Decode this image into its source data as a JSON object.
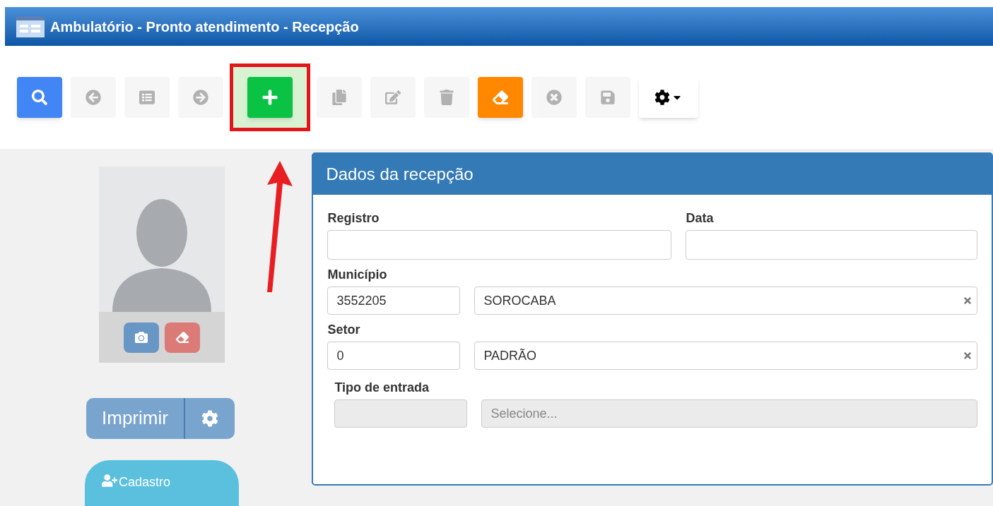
{
  "window": {
    "title": "Ambulatório - Pronto atendimento - Recepção"
  },
  "toolbar": [
    {
      "kind": "search",
      "disabled": false,
      "highlighted": false
    },
    {
      "kind": "previous",
      "disabled": true,
      "highlighted": false
    },
    {
      "kind": "list",
      "disabled": true,
      "highlighted": false
    },
    {
      "kind": "next",
      "disabled": true,
      "highlighted": false
    },
    {
      "kind": "add",
      "disabled": false,
      "highlighted": true
    },
    {
      "kind": "copy",
      "disabled": true,
      "highlighted": false
    },
    {
      "kind": "edit",
      "disabled": true,
      "highlighted": false
    },
    {
      "kind": "delete",
      "disabled": true,
      "highlighted": false
    },
    {
      "kind": "clear",
      "disabled": false,
      "highlighted": false
    },
    {
      "kind": "cancel",
      "disabled": true,
      "highlighted": false
    },
    {
      "kind": "save",
      "disabled": true,
      "highlighted": false
    },
    {
      "kind": "settings",
      "disabled": false,
      "highlighted": false
    }
  ],
  "sidebar": {
    "print_button": "Imprimir",
    "register_button": "Cadastro"
  },
  "panel": {
    "title": "Dados da recepção",
    "fields": [
      {
        "label": "Registro"
      },
      {
        "label": "Data"
      }
    ],
    "lookups": [
      {
        "label": "Município",
        "code": "3552205",
        "name": "SOROCABA",
        "disabled": false
      },
      {
        "label": "Setor",
        "code": "0",
        "name": "PADRÃO",
        "disabled": false
      },
      {
        "label": "Tipo de entrada",
        "placeholder": "Selecione...",
        "disabled": true
      }
    ]
  }
}
